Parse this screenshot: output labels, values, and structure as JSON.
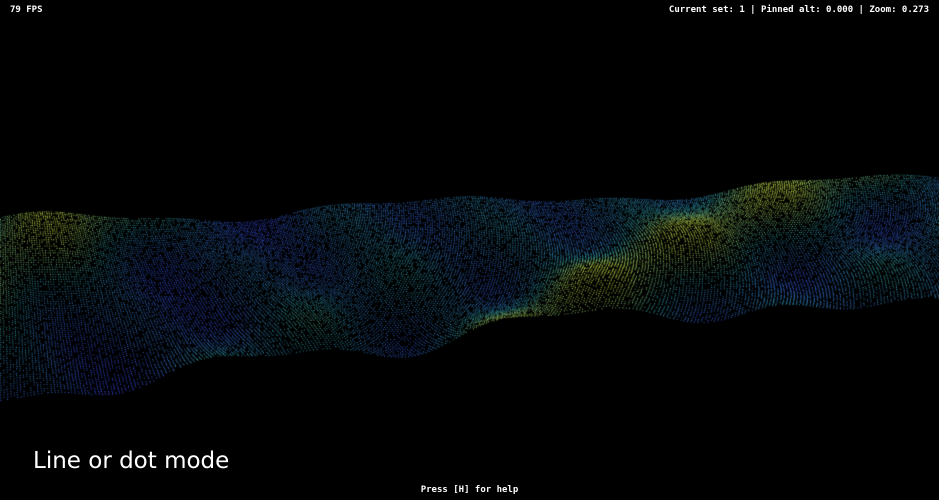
{
  "hud": {
    "fps": "79 FPS",
    "status": "Current set: 1 | Pinned alt: 0.000 | Zoom: 0.273",
    "help_hint": "Press [H] for help"
  },
  "caption": "Line or dot mode",
  "colors": {
    "background": "#000000",
    "hud_text": "#ffffff",
    "terrain_low": "#3a4fd8",
    "terrain_mid": "#2f8fa0",
    "terrain_high": "#b7d24a"
  }
}
